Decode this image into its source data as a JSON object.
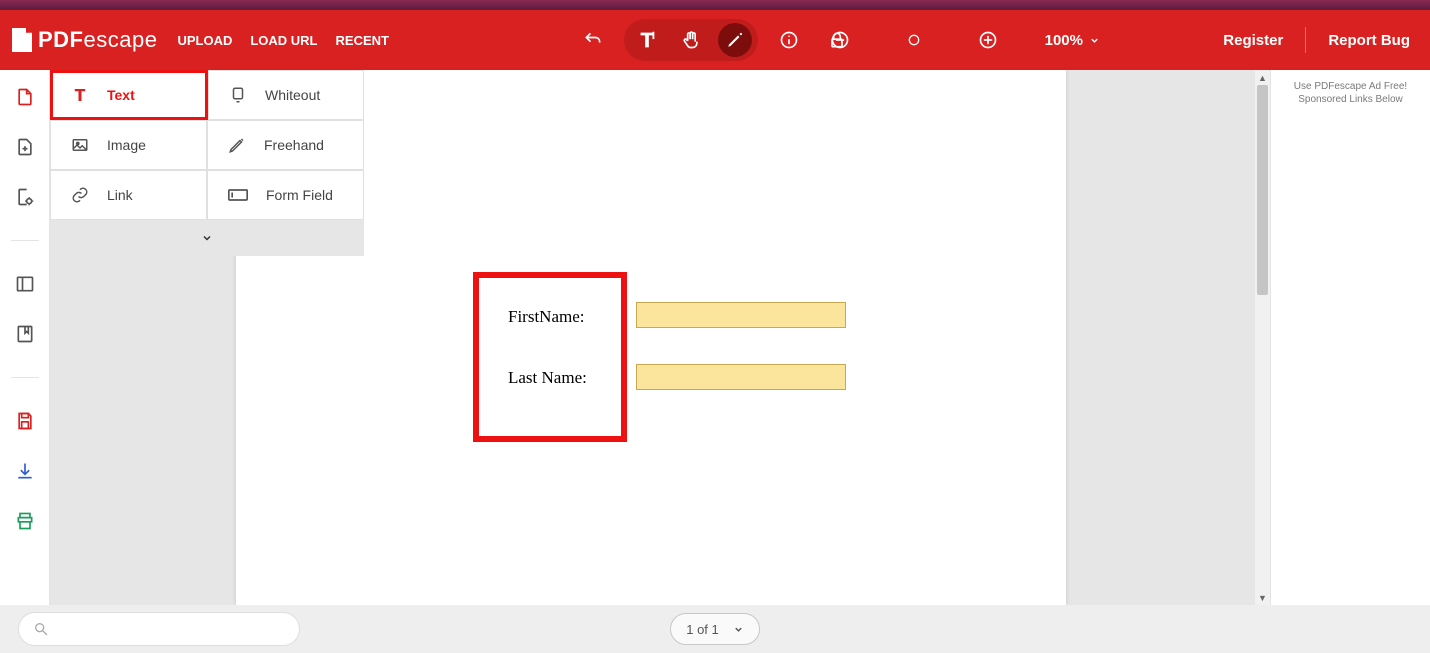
{
  "app": {
    "logo_prefix": "PDF",
    "logo_suffix": "escape"
  },
  "header_menu": {
    "upload": "UPLOAD",
    "load_url": "LOAD URL",
    "recent": "RECENT"
  },
  "zoom": {
    "value": "100%"
  },
  "links": {
    "register": "Register",
    "report_bug": "Report Bug"
  },
  "tools": {
    "text": "Text",
    "whiteout": "Whiteout",
    "image": "Image",
    "freehand": "Freehand",
    "link": "Link",
    "form_field": "Form Field"
  },
  "doc": {
    "label_firstname": "FirstName:",
    "label_lastname": "Last Name:"
  },
  "ads": {
    "line1": "Use PDFescape Ad Free!",
    "line2": "Sponsored Links Below"
  },
  "footer": {
    "page_indicator": "1 of 1"
  }
}
